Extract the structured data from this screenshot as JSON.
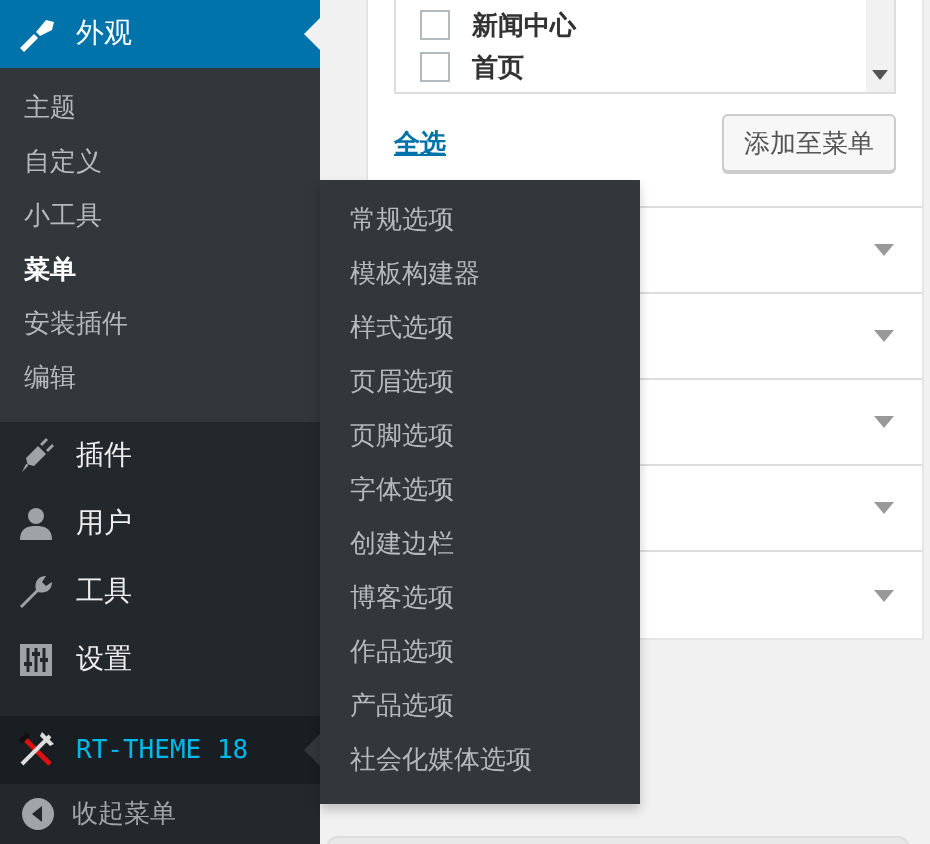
{
  "sidebar": {
    "items": [
      {
        "label": "外观",
        "selected": true,
        "highlighted": false,
        "children": [
          {
            "label": "主题",
            "selected": false
          },
          {
            "label": "自定义",
            "selected": false
          },
          {
            "label": "小工具",
            "selected": false
          },
          {
            "label": "菜单",
            "selected": true
          },
          {
            "label": "安装插件",
            "selected": false
          },
          {
            "label": "编辑",
            "selected": false
          }
        ]
      },
      {
        "label": "插件",
        "selected": false,
        "highlighted": false
      },
      {
        "label": "用户",
        "selected": false,
        "highlighted": false
      },
      {
        "label": "工具",
        "selected": false,
        "highlighted": false
      },
      {
        "label": "设置",
        "selected": false,
        "highlighted": false
      },
      {
        "label": "RT-THEME 18",
        "selected": false,
        "highlighted": true,
        "flyout": [
          "常规选项",
          "模板构建器",
          "样式选项",
          "页眉选项",
          "页脚选项",
          "字体选项",
          "创建边栏",
          "博客选项",
          "作品选项",
          "产品选项",
          "社会化媒体选项"
        ]
      }
    ],
    "collapse_label": "收起菜单"
  },
  "menu_items_box": {
    "items": [
      {
        "label": "新闻中心",
        "checked": false
      },
      {
        "label": "首页",
        "checked": false
      }
    ],
    "select_all": "全选",
    "add_button": "添加至菜单"
  },
  "sections": [
    {
      "expanded": false
    },
    {
      "expanded": false
    },
    {
      "expanded": false
    },
    {
      "expanded": false
    },
    {
      "expanded": false
    }
  ]
}
